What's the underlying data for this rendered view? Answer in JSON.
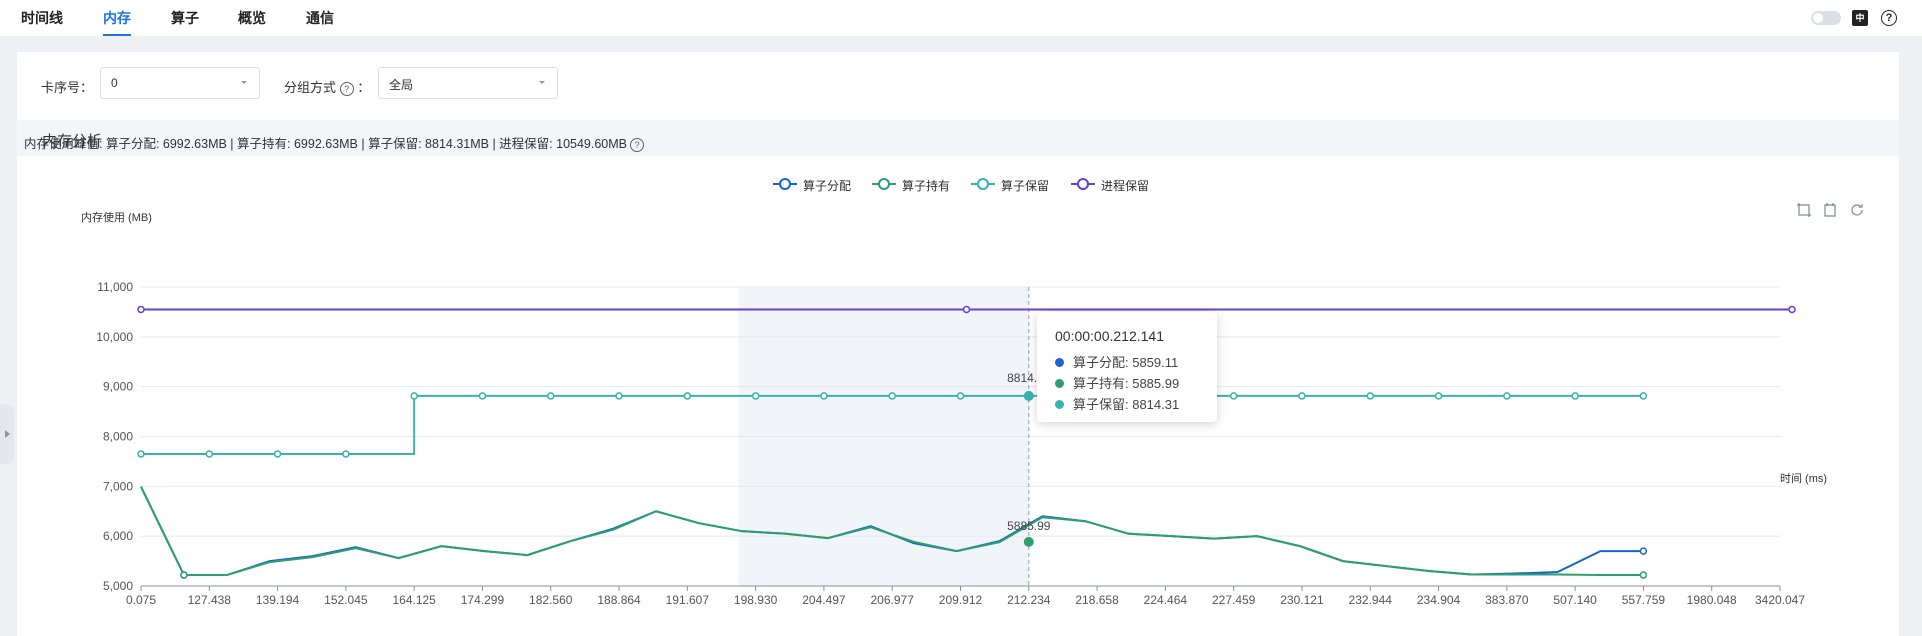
{
  "tabs": [
    {
      "label": "时间线",
      "active": false
    },
    {
      "label": "内存",
      "active": true
    },
    {
      "label": "算子",
      "active": false
    },
    {
      "label": "概览",
      "active": false
    },
    {
      "label": "通信",
      "active": false
    }
  ],
  "top_icons": [
    "theme-toggle-icon",
    "language-icon",
    "help-icon"
  ],
  "language_icon_text": "中",
  "filters": {
    "card_label": "卡序号：",
    "card_value": "0",
    "group_label": "分组方式",
    "group_colon": "：",
    "group_value": "全局"
  },
  "section_title": "内存分析",
  "peak_text": "内存使用峰值: 算子分配: 6992.63MB | 算子持有: 6992.63MB | 算子保留: 8814.31MB | 进程保留: 10549.60MB",
  "help_glyph": "?",
  "chart_data": {
    "type": "line",
    "ylabel": "内存使用 (MB)",
    "xlabel": "时间 (ms)",
    "ylim": [
      5000,
      11000
    ],
    "y_ticks": [
      "5,000",
      "6,000",
      "7,000",
      "8,000",
      "9,000",
      "10,000",
      "11,000"
    ],
    "x_ticks": [
      "0.075",
      "127.438",
      "139.194",
      "152.045",
      "164.125",
      "174.299",
      "182.560",
      "188.864",
      "191.607",
      "198.930",
      "204.497",
      "206.977",
      "209.912",
      "212.234",
      "218.658",
      "224.464",
      "227.459",
      "230.121",
      "232.944",
      "234.904",
      "383.870",
      "507.140",
      "557.759",
      "1980.048",
      "3420.047"
    ],
    "legend_position": "top-center",
    "grid": true,
    "colors": {
      "算子分配": "#1763d4",
      "算子持有": "#2d9e6e",
      "算子保留": "#37b3b0",
      "进程保留": "#6a3fd0"
    },
    "series": [
      {
        "name": "算子分配",
        "values": [
          6992,
          5220,
          5220,
          5500,
          5600,
          5780,
          5560,
          5800,
          5700,
          5620,
          5900,
          6150,
          6500,
          6260,
          6100,
          6050,
          5960,
          6200,
          5859,
          5700,
          5900,
          6400,
          6300,
          6050,
          6000,
          5950,
          6000,
          5800,
          5500,
          5400,
          5300,
          5230,
          5250,
          5280,
          5700,
          5700
        ]
      },
      {
        "name": "算子持有",
        "values": [
          6992,
          5220,
          5220,
          5480,
          5580,
          5760,
          5560,
          5800,
          5700,
          5620,
          5900,
          6130,
          6500,
          6260,
          6100,
          6050,
          5960,
          6180,
          5886,
          5700,
          5880,
          6380,
          6300,
          6050,
          6000,
          5950,
          6000,
          5800,
          5500,
          5400,
          5300,
          5230,
          5230,
          5230,
          5220,
          5220
        ]
      },
      {
        "name": "算子保留",
        "values": [
          7650,
          7650,
          7650,
          7650,
          8814,
          8814,
          8814,
          8814,
          8814,
          8814,
          8814,
          8814,
          8814,
          8814,
          8814,
          8814,
          8814,
          8814,
          8814,
          8814,
          8814,
          8814,
          8814
        ]
      },
      {
        "name": "进程保留",
        "values": [
          10549.6,
          10549.6,
          10549.6
        ]
      }
    ],
    "hover": {
      "x": "212.234",
      "label_retained": "8814.31",
      "label_held": "5885.99"
    }
  },
  "tooltip": {
    "title": "00:00:00.212.141",
    "rows": [
      {
        "label": "算子分配: 5859.11",
        "color": "#1763d4"
      },
      {
        "label": "算子持有: 5885.99",
        "color": "#2d9e6e"
      },
      {
        "label": "算子保留: 8814.31",
        "color": "#37b3b0"
      }
    ]
  }
}
